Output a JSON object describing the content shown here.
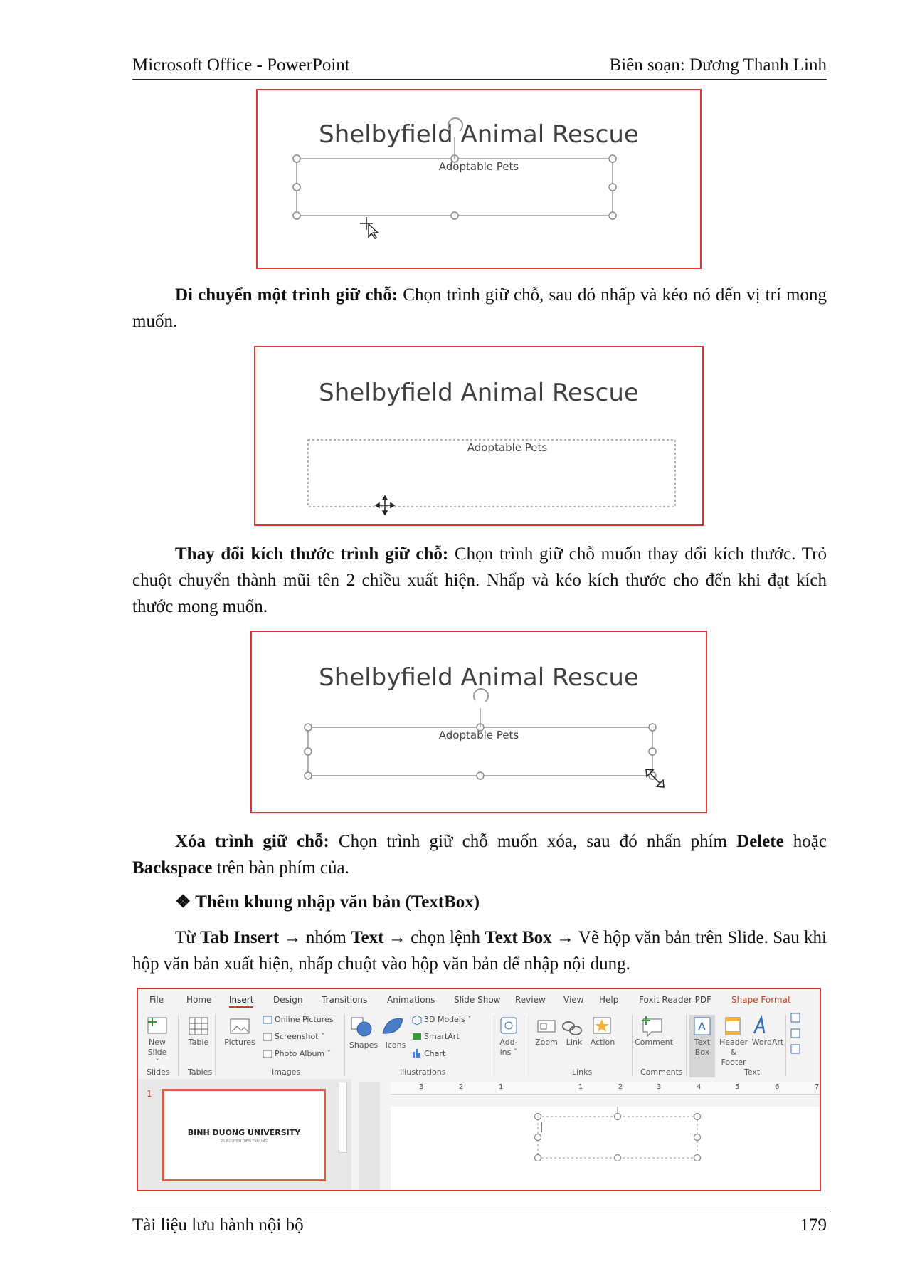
{
  "header": {
    "left": "Microsoft Office - PowerPoint",
    "right": "Biên soạn: Dương Thanh Linh"
  },
  "figures": {
    "title": "Shelbyfield Animal Rescue",
    "subtitle": "Adoptable Pets"
  },
  "sections": {
    "move": {
      "bold": "Di chuyển một trình giữ chỗ:",
      "text": " Chọn trình giữ chỗ, sau đó nhấp và kéo nó đến vị trí mong muốn."
    },
    "resize": {
      "bold": "Thay đổi kích thước trình giữ chỗ:",
      "text": " Chọn trình giữ chỗ muốn thay đổi kích thước. Trỏ chuột chuyển thành mũi tên 2 chiều xuất hiện. Nhấp và kéo kích thước cho đến khi đạt kích thước mong muốn."
    },
    "delete": {
      "bold": "Xóa trình giữ chỗ:",
      "text1": " Chọn trình giữ chỗ muốn xóa, sau đó nhấn phím ",
      "bold2": "Delete",
      "text2": " hoặc ",
      "bold3": "Backspace",
      "text3": " trên bàn phím của."
    },
    "textbox_heading": "❖ Thêm khung nhập văn bản (TextBox)",
    "textbox": {
      "t1": "Từ ",
      "b1": "Tab Insert",
      "t2": " → nhóm ",
      "b2": "Text",
      "t3": " → chọn lệnh ",
      "b3": "Text Box",
      "t4": " → Vẽ hộp văn bản trên Slide. Sau khi hộp văn bản xuất hiện, nhấp chuột vào hộp văn bản để nhập nội dung."
    }
  },
  "ribbon": {
    "tabs": [
      "File",
      "Home",
      "Insert",
      "Design",
      "Transitions",
      "Animations",
      "Slide Show",
      "Review",
      "View",
      "Help",
      "Foxit Reader PDF",
      "Shape Format"
    ],
    "buttons": {
      "new_slide": "New Slide ˇ",
      "table": "Table",
      "pictures": "Pictures",
      "online_pictures": "Online Pictures",
      "screenshot": "Screenshot ˇ",
      "photo_album": "Photo Album ˇ",
      "shapes": "Shapes",
      "icons": "Icons",
      "models": "3D Models ˇ",
      "smartart": "SmartArt",
      "chart": "Chart",
      "addins": "Add-ins ˇ",
      "zoom": "Zoom",
      "link": "Link",
      "action": "Action",
      "comment": "Comment",
      "textbox": "Text Box",
      "header_footer": "Header & Footer",
      "wordart": "WordArt"
    },
    "groups": [
      "Slides",
      "Tables",
      "Images",
      "Illustrations",
      "Links",
      "Comments",
      "Text"
    ],
    "ruler_numbers": [
      "3",
      "2",
      "1",
      "1",
      "2",
      "3",
      "4",
      "5",
      "6",
      "7"
    ],
    "slide_number": "1",
    "thumb_title": "BINH DUONG UNIVERSITY",
    "thumb_sub": "26 NGUYEN DIEN TRUONG"
  },
  "footer": {
    "left": "Tài liệu lưu hành nội bộ",
    "right": "179"
  }
}
